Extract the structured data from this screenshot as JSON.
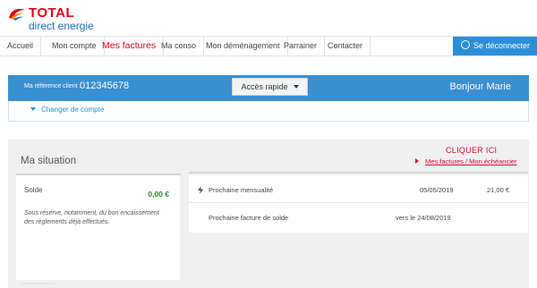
{
  "brand": {
    "name": "TOTAL",
    "subtitle": "direct energie",
    "colors": {
      "red": "#e2001a",
      "blue": "#1e6db5",
      "bar_blue": "#3a8fd1",
      "green": "#2e8a2e"
    }
  },
  "nav": {
    "items": [
      {
        "label": "Accueil"
      },
      {
        "label": "Mon compte"
      },
      {
        "label": "Mes factures",
        "active": true
      },
      {
        "label": "Ma conso"
      },
      {
        "label": "Mon déménagement"
      },
      {
        "label": "Parrainer"
      },
      {
        "label": "Contacter"
      }
    ],
    "logout_label": "Se déconnecter",
    "logout_icon": "power-icon"
  },
  "client_bar": {
    "ref_label": "Ma référence client :",
    "ref_number": "012345678",
    "quick_access_label": "Accès rapide",
    "greeting": "Bonjour Marie",
    "change_account_label": "Changer de compte"
  },
  "situation": {
    "title": "Ma situation",
    "callout": "CLIQUER ICI",
    "invoices_link": "Mes factures / Mon échéancier",
    "balance": {
      "label": "Solde",
      "amount": "0,00 €",
      "note": "Sous réserve, notamment, du bon encaissement des règlements déjà effectués."
    },
    "upcoming": [
      {
        "label": "Prochaine mensualité",
        "date": "05/05/2019",
        "amount": "21,00 €",
        "icon": "bolt-icon"
      },
      {
        "label": "Prochaine facture de solde",
        "date": "vers le 24/08/2019",
        "amount": ""
      }
    ]
  }
}
